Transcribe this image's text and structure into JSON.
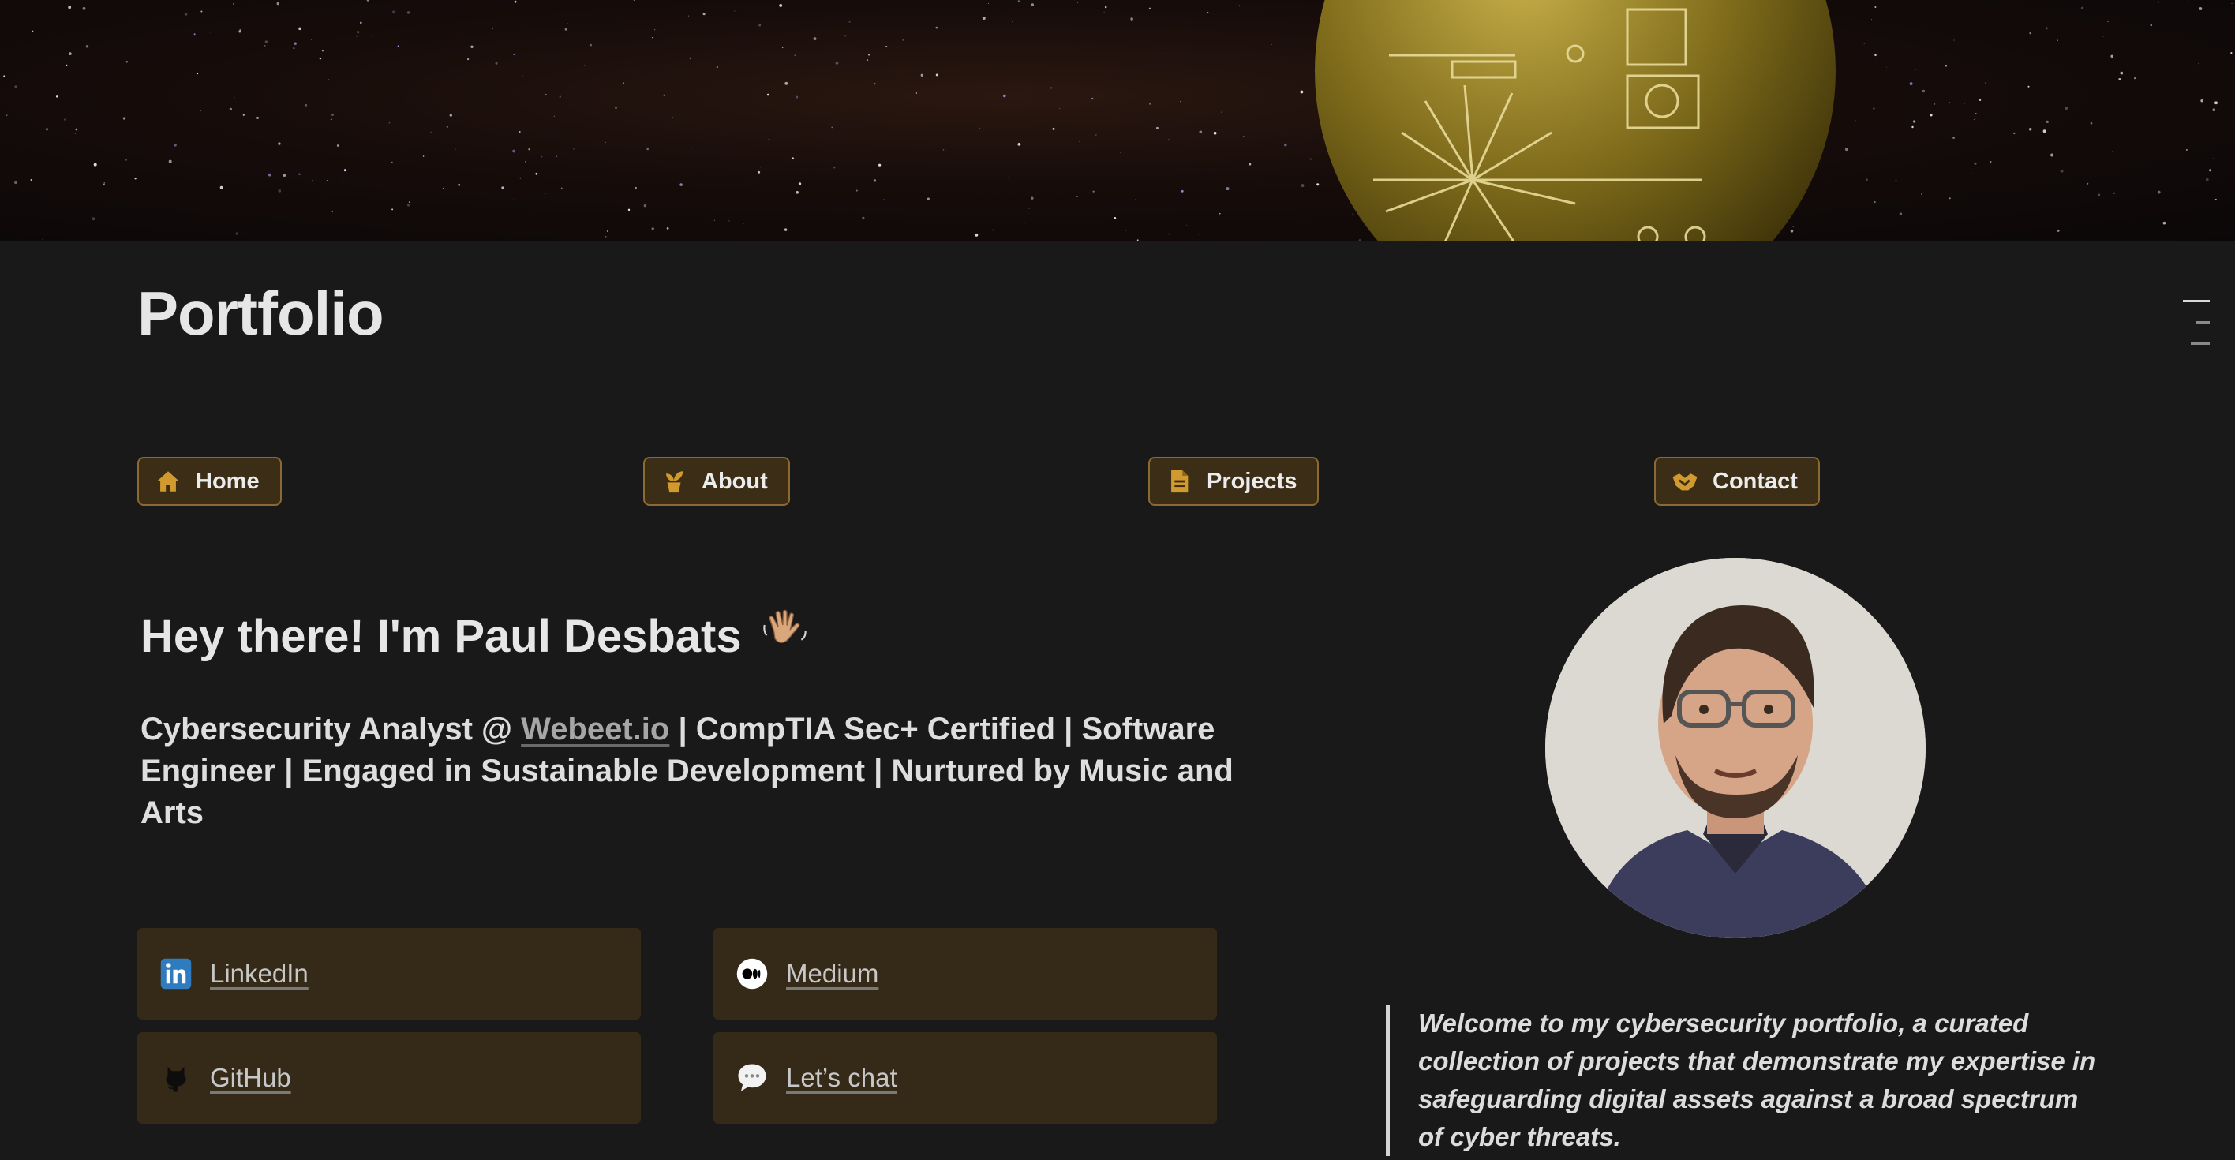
{
  "page": {
    "title": "Portfolio"
  },
  "nav": [
    {
      "label": "Home",
      "icon": "house-icon"
    },
    {
      "label": "About",
      "icon": "potted-plant-icon"
    },
    {
      "label": "Projects",
      "icon": "document-icon"
    },
    {
      "label": "Contact",
      "icon": "handshake-icon"
    }
  ],
  "hero": {
    "heading": "Hey there! I'm Paul Desbats",
    "wave_icon": "waving-hand-icon",
    "tagline_prefix": "Cybersecurity Analyst @ ",
    "tagline_link": "Webeet.io",
    "tagline_suffix": " | CompTIA Sec+ Certified | Software Engineer | Engaged in Sustainable Development | Nurtured by Music and Arts"
  },
  "links": [
    {
      "label": "LinkedIn",
      "icon": "linkedin-icon"
    },
    {
      "label": "Medium",
      "icon": "medium-icon"
    },
    {
      "label": "GitHub",
      "icon": "github-icon"
    },
    {
      "label": "Let’s chat",
      "icon": "speech-bubble-icon"
    }
  ],
  "quote": {
    "text": "Welcome to my cybersecurity portfolio, a curated collection of projects that demonstrate my expertise in safeguarding digital assets against a broad spectrum of cyber threats."
  },
  "colors": {
    "background": "#191919",
    "accent_gold": "#c9932e",
    "button_bg": "#3c2e16",
    "card_bg": "#352918"
  }
}
